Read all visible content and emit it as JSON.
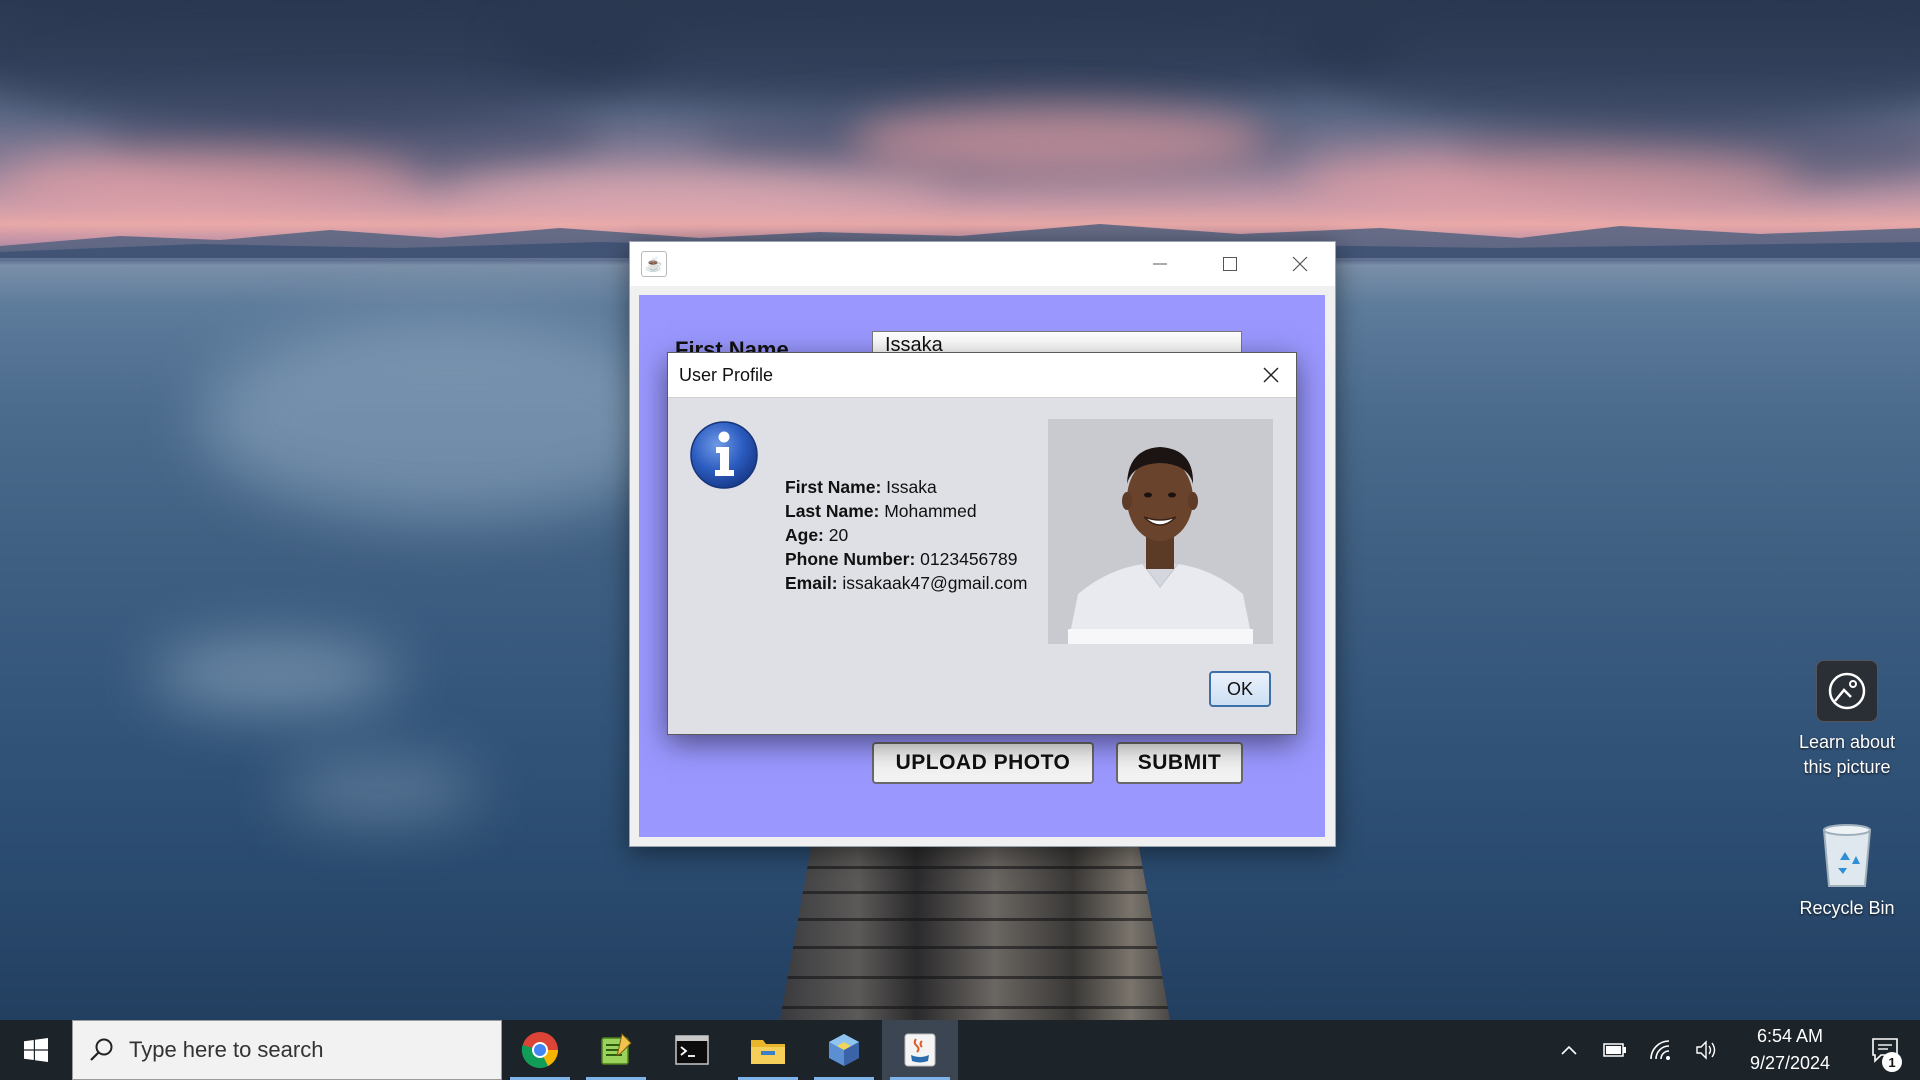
{
  "desktop": {
    "icons": [
      {
        "label_line1": "Learn about",
        "label_line2": "this picture",
        "icon": "learn-about-picture-icon"
      },
      {
        "label": "Recycle Bin",
        "icon": "recycle-bin-icon"
      }
    ]
  },
  "app_window": {
    "title": "",
    "controls": {
      "minimize": "minimize-icon",
      "maximize": "maximize-icon",
      "close": "close-icon"
    },
    "form": {
      "first_name_label": "First Name",
      "first_name_value": "Issaka"
    },
    "buttons": {
      "upload_photo": "UPLOAD PHOTO",
      "submit": "SUBMIT"
    },
    "background_color": "#9a98ff"
  },
  "dialog": {
    "title": "User Profile",
    "icon": "info-icon",
    "fields": [
      {
        "label": "First Name:",
        "value": " Issaka"
      },
      {
        "label": "Last Name:",
        "value": " Mohammed"
      },
      {
        "label": "Age:",
        "value": " 20"
      },
      {
        "label": "Phone Number:",
        "value": " 0123456789"
      },
      {
        "label": "Email:",
        "value": " issakaak47@gmail.com"
      }
    ],
    "photo": "profile-photo",
    "ok_button": "OK"
  },
  "taskbar": {
    "search_placeholder": "Type here to search",
    "apps": [
      {
        "name": "chrome-icon"
      },
      {
        "name": "notepad-plus-plus-icon"
      },
      {
        "name": "terminal-icon"
      },
      {
        "name": "file-explorer-icon"
      },
      {
        "name": "virtualbox-icon"
      },
      {
        "name": "java-icon",
        "active": true
      }
    ],
    "tray": {
      "time": "6:54 AM",
      "date": "9/27/2024",
      "notification_count": "1"
    }
  }
}
